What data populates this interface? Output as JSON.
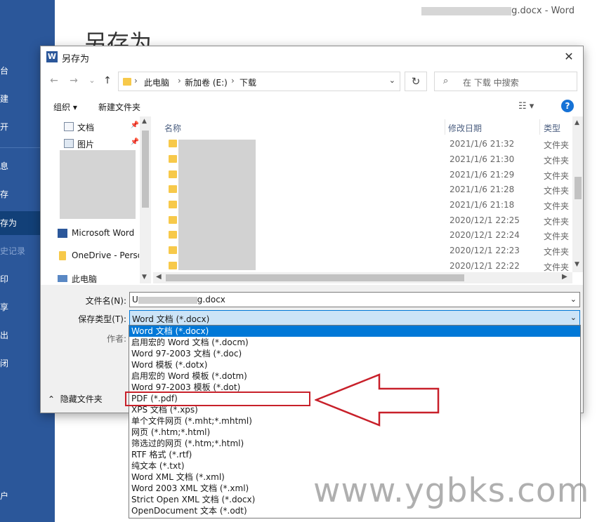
{
  "backstage": {
    "title": "另存为",
    "doc_suffix": "g.docx",
    "app_name": "Word",
    "nav": [
      "台",
      "建",
      "开",
      "息",
      "存",
      "存为",
      "史记录",
      "印",
      "享",
      "出",
      "闭",
      "户"
    ]
  },
  "dialog": {
    "title": "另存为",
    "close": "✕",
    "nav": {
      "back": "←",
      "forward": "→",
      "recent": "⌄",
      "up": "↑"
    },
    "address": {
      "crumbs": [
        "此电脑",
        "新加卷 (E:)",
        "下载"
      ],
      "separator": "›",
      "dropdown": "⌄"
    },
    "refresh": "↻",
    "search_placeholder": "在 下载 中搜索",
    "toolbar": {
      "organize": "组织 ▾",
      "new_folder": "新建文件夹",
      "view": "☷ ▾",
      "help": "?"
    },
    "tree": [
      {
        "label": "文档",
        "pin": "📌"
      },
      {
        "label": "图片",
        "pin": "📌"
      },
      {
        "label": "Microsoft Word"
      },
      {
        "label": "OneDrive - Perso"
      },
      {
        "label": "此电脑"
      }
    ],
    "columns": {
      "name": "名称",
      "date": "修改日期",
      "type": "类型"
    },
    "rows": [
      {
        "date": "2021/1/6 21:32",
        "type": "文件夹"
      },
      {
        "date": "2021/1/6 21:30",
        "type": "文件夹"
      },
      {
        "date": "2021/1/6 21:29",
        "type": "文件夹"
      },
      {
        "date": "2021/1/6 21:28",
        "type": "文件夹"
      },
      {
        "date": "2021/1/6 21:18",
        "type": "文件夹"
      },
      {
        "date": "2020/12/1 22:25",
        "type": "文件夹"
      },
      {
        "date": "2020/12/1 22:24",
        "type": "文件夹"
      },
      {
        "date": "2020/12/1 22:23",
        "type": "文件夹"
      },
      {
        "date": "2020/12/1 22:22",
        "type": "文件夹"
      }
    ],
    "filename_label": "文件名(N):",
    "filename_prefix": "U",
    "filename_suffix": "g.docx",
    "savetype_label": "保存类型(T):",
    "savetype_value": "Word 文档 (*.docx)",
    "author_label": "作者:",
    "hide_folders": "隐藏文件夹"
  },
  "dropdown_options": [
    "Word 文档 (*.docx)",
    "启用宏的 Word 文档 (*.docm)",
    "Word 97-2003 文档 (*.doc)",
    "Word 模板 (*.dotx)",
    "启用宏的 Word 模板 (*.dotm)",
    "Word 97-2003 模板 (*.dot)",
    "PDF (*.pdf)",
    "XPS 文档 (*.xps)",
    "单个文件网页 (*.mht;*.mhtml)",
    "网页 (*.htm;*.html)",
    "筛选过的网页 (*.htm;*.html)",
    "RTF 格式 (*.rtf)",
    "纯文本 (*.txt)",
    "Word XML 文档 (*.xml)",
    "Word 2003 XML 文档 (*.xml)",
    "Strict Open XML 文档 (*.docx)",
    "OpenDocument 文本 (*.odt)"
  ],
  "selected_option_index": 0,
  "highlighted_option_index": 6,
  "watermark": "www.ygbks.com",
  "colors": {
    "word_blue": "#2b579a",
    "selection": "#0078d7",
    "annotation_red": "#c8202a"
  }
}
